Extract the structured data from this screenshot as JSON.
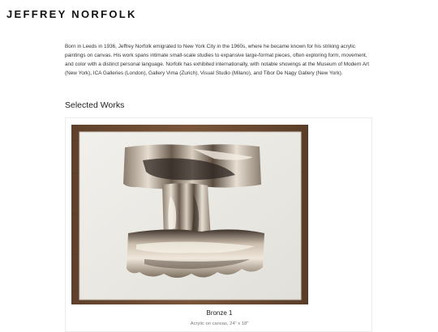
{
  "header": {
    "site_title": "JEFFREY NORFOLK"
  },
  "bio": {
    "text": "Born in Leeds in 1936, Jeffrey Norfolk emigrated to New York City in the 1960s, where he became known for his striking acrylic paintings on canvas. His work spans intimate small-scale studies to expansive large-format pieces, often exploring form, movement, and color with a distinct personal language. Norfolk has exhibited internationally, with notable showings at the Museum of Modern Art (New York), ICA Galleries (London), Gallery Vima (Zurich), Visual Studio (Milano), and Tibor De Nagy Gallery (New York)."
  },
  "selected_works": {
    "heading": "Selected Works",
    "items": [
      {
        "title": "Bronze 1",
        "medium_size": "Acrylic on canvas, 24\" x 18\""
      }
    ]
  },
  "colors": {
    "frame_wood": "#6a4a32",
    "canvas_white": "#ecebe6",
    "metal_light": "#cfc5b6",
    "metal_dark": "#4a3f36"
  }
}
